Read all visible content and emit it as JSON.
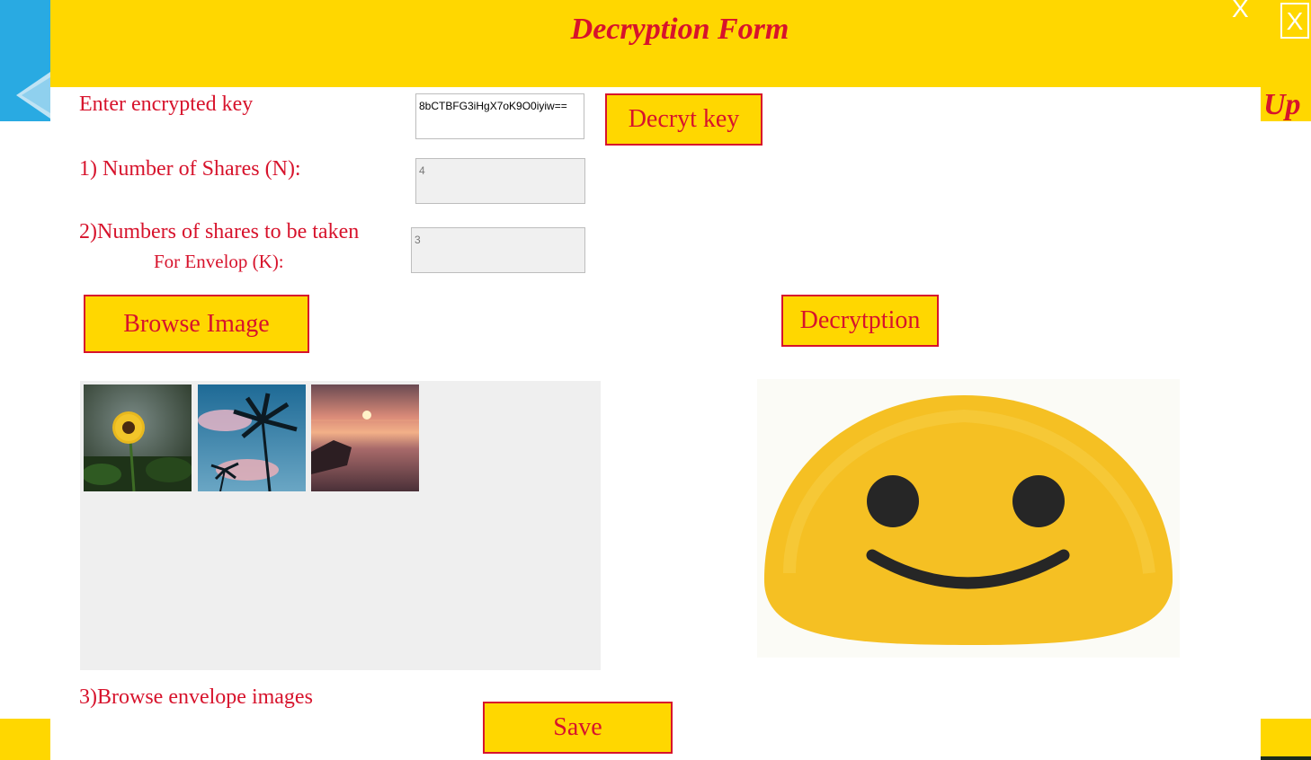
{
  "header": {
    "title": "Decryption Form",
    "minimize_glyph": "X",
    "close_glyph": "X",
    "up_label": "Up"
  },
  "form": {
    "key_label": "Enter encrypted key",
    "key_value": "8bCTBFG3iHgX7oK9O0iyiw==",
    "shares_n_label": "1) Number of Shares (N):",
    "shares_n_value": "4",
    "shares_k_label_line1": "2)Numbers of shares to be taken",
    "shares_k_label_line2": "For Envelop (K):",
    "shares_k_value": "3",
    "envelope_label": "3)Browse envelope images"
  },
  "buttons": {
    "decrypt_key": "Decryt key",
    "browse_image": "Browse Image",
    "decryption": "Decrytption",
    "save": "Save"
  },
  "thumbnails": [
    "sunflower",
    "palm-trees-sky",
    "sunset-sea"
  ],
  "colors": {
    "accent_yellow": "#ffd700",
    "text_red": "#d7132c",
    "side_blue": "#29aae2",
    "panel_gray": "#efefef"
  }
}
